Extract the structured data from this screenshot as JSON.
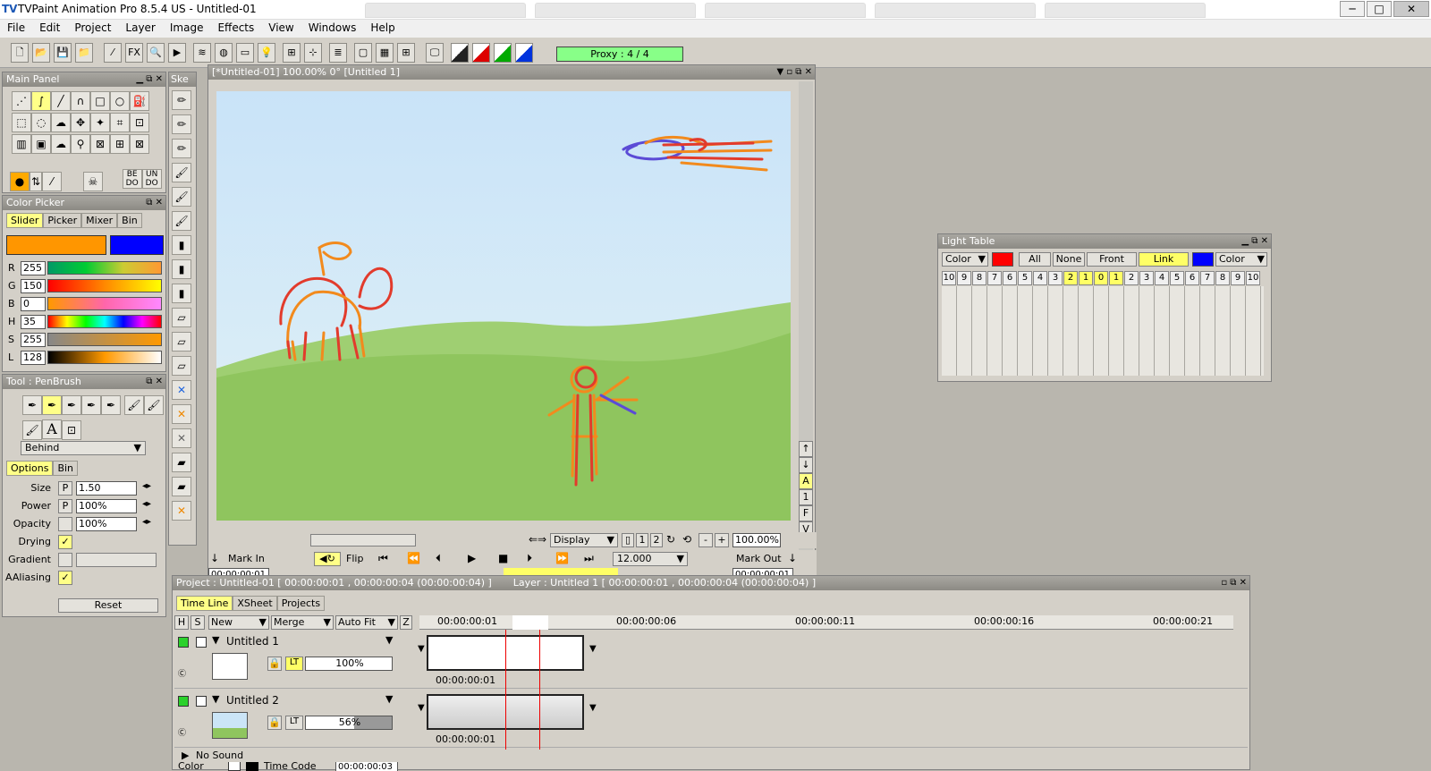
{
  "app": {
    "title": "TVPaint Animation Pro 8.5.4 US - Untitled-01",
    "logo": "TV"
  },
  "window_controls": [
    "─",
    "□",
    "✕"
  ],
  "menu": [
    "File",
    "Edit",
    "Project",
    "Layer",
    "Image",
    "Effects",
    "View",
    "Windows",
    "Help"
  ],
  "toolbar": {
    "proxy": "Proxy : 4 / 4",
    "fx": "FX"
  },
  "main_panel": {
    "title": "Main Panel",
    "undo_label": "BE DO",
    "redo_label": "UN DO"
  },
  "sketch_panel": {
    "title": "Ske"
  },
  "color_picker": {
    "title": "Color Picker",
    "tabs": [
      "Slider",
      "Picker",
      "Mixer",
      "Bin"
    ],
    "primary_color": "#ff9600",
    "secondary_color": "#0000ff",
    "rows": [
      {
        "label": "R",
        "value": "255"
      },
      {
        "label": "G",
        "value": "150"
      },
      {
        "label": "B",
        "value": "0"
      },
      {
        "label": "H",
        "value": "35"
      },
      {
        "label": "S",
        "value": "255"
      },
      {
        "label": "L",
        "value": "128"
      }
    ]
  },
  "tool_panel": {
    "title": "Tool : PenBrush",
    "mode": "Behind",
    "tabs": [
      "Options",
      "Bin"
    ],
    "text_tool": "A",
    "options": [
      {
        "label": "Size",
        "flag": "P",
        "value": "1.50"
      },
      {
        "label": "Power",
        "flag": "P",
        "value": "100%"
      },
      {
        "label": "Opacity",
        "flag": "",
        "value": "100%"
      }
    ],
    "drying": "Drying",
    "gradient": "Gradient",
    "aaliasing": "AAliasing",
    "check": "✓",
    "reset": "Reset"
  },
  "canvas_window": {
    "title": "[*Untitled-01]  100.00%   0°  [Untitled 1]",
    "display": "Display",
    "zoom": "100.00%",
    "mark_in": "Mark In",
    "mark_out": "Mark Out",
    "flip": "Flip",
    "fps": "12.000",
    "timecode_left": "00:00:00:01",
    "timecode_right": "00:00:00:01",
    "zoom_minus": "-",
    "zoom_plus": "+",
    "side_letters": [
      "A",
      "1",
      "F",
      "V"
    ],
    "page_nums": [
      "1",
      "2"
    ]
  },
  "light_table": {
    "title": "Light Table",
    "left_color_label": "Color",
    "left_color": "#ff0000",
    "buttons": [
      "All",
      "None",
      "Front",
      "Link"
    ],
    "right_color_label": "Color",
    "right_color": "#0000ff",
    "numbers": [
      "10",
      "9",
      "8",
      "7",
      "6",
      "5",
      "4",
      "3",
      "2",
      "1",
      "0",
      "1",
      "2",
      "3",
      "4",
      "5",
      "6",
      "7",
      "8",
      "9",
      "10"
    ]
  },
  "timeline": {
    "header": "Project : Untitled-01 [ 00:00:00:01 , 00:00:00:04  (00:00:00:04) ]",
    "layer_info": "Layer : Untitled 1 [ 00:00:00:01 , 00:00:00:04  (00:00:00:04) ]",
    "tabs": [
      "Time Line",
      "XSheet",
      "Projects"
    ],
    "columns": {
      "h": "H",
      "s": "S",
      "new": "New",
      "merge": "Merge",
      "autofit": "Auto Fit",
      "z": "Z"
    },
    "ruler": [
      "00:00:00:01",
      "00:00:00:06",
      "00:00:00:11",
      "00:00:00:16",
      "00:00:00:21"
    ],
    "layers": [
      {
        "name": "Untitled 1",
        "opacity": "100%",
        "start": "00:00:00:01",
        "lt": "LT"
      },
      {
        "name": "Untitled 2",
        "opacity": "56%",
        "start": "00:00:00:01",
        "lt": "LT"
      }
    ],
    "sound": "No Sound",
    "color_label": "Color",
    "timecode_label": "Time Code",
    "timecode_value": "00:00:00:03"
  }
}
